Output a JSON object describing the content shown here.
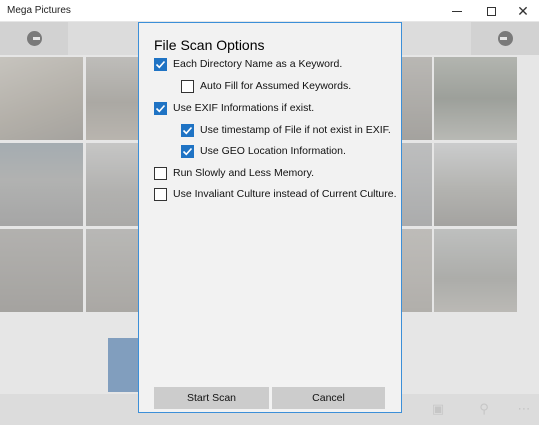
{
  "window": {
    "title": "Mega Pictures",
    "minimize_icon": "minimize-icon",
    "maximize_icon": "maximize-icon",
    "close_icon": "close-icon"
  },
  "toolbar": {
    "prev_icon": "back-circle-icon",
    "next_icon": "forward-circle-icon"
  },
  "dialog": {
    "title": "File Scan Options",
    "options": [
      {
        "label": "Each Directory Name as a Keyword.",
        "checked": true
      },
      {
        "label": "Auto Fill for Assumed Keywords.",
        "checked": false
      },
      {
        "label": "Use EXIF Informations if exist.",
        "checked": true
      },
      {
        "label": "Use timestamp of File if not exist in EXIF.",
        "checked": true
      },
      {
        "label": "Use GEO Location Information.",
        "checked": true
      },
      {
        "label": "Run Slowly and Less Memory.",
        "checked": false
      },
      {
        "label": "Use Invaliant Culture instead of Current Culture.",
        "checked": false
      }
    ],
    "start_label": "Start Scan",
    "cancel_label": "Cancel"
  },
  "bottombar": {
    "icons": [
      "slideshow-icon",
      "search-icon",
      "more-icon"
    ]
  },
  "colors": {
    "accent": "#1f73c4",
    "dialog_border": "#3c8fd8",
    "dialog_bg": "#f2f2f2",
    "button_bg": "#cccccc"
  }
}
